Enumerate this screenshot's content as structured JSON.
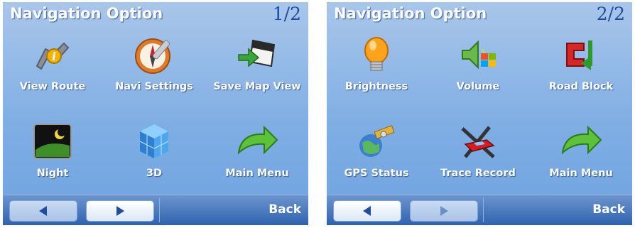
{
  "screens": [
    {
      "title": "Navigation Option",
      "page": "1/2",
      "items": [
        {
          "label": "View Route",
          "icon": "view-route-icon"
        },
        {
          "label": "Navi Settings",
          "icon": "compass-wrench-icon"
        },
        {
          "label": "Save Map View",
          "icon": "save-card-icon"
        },
        {
          "label": "Night",
          "icon": "night-moon-icon"
        },
        {
          "label": "3D",
          "icon": "cubes-3d-icon"
        },
        {
          "label": "Main Menu",
          "icon": "green-arrow-icon"
        }
      ],
      "nav": {
        "back": "Back",
        "active_button": "next"
      }
    },
    {
      "title": "Navigation Option",
      "page": "2/2",
      "items": [
        {
          "label": "Brightness",
          "icon": "bulb-icon"
        },
        {
          "label": "Volume",
          "icon": "speaker-icon"
        },
        {
          "label": "Road Block",
          "icon": "road-block-icon"
        },
        {
          "label": "GPS Status",
          "icon": "satellite-icon"
        },
        {
          "label": "Trace Record",
          "icon": "race-car-icon"
        },
        {
          "label": "Main Menu",
          "icon": "green-arrow-icon"
        }
      ],
      "nav": {
        "back": "Back",
        "active_button": "prev"
      }
    }
  ],
  "colors": {
    "accent": "#1d4f9c",
    "bar_top": "#6c95cf",
    "bar_bottom": "#2f62ae"
  }
}
